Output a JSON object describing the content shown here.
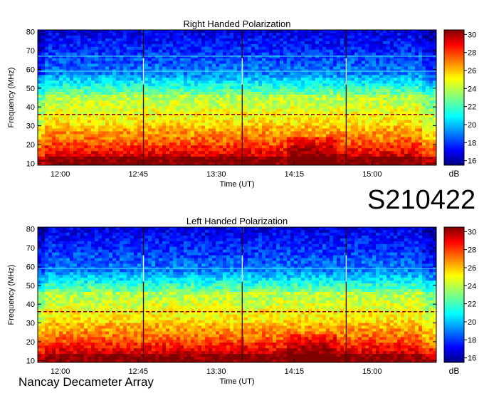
{
  "observation_code": "S210422",
  "footer": "Nancay Decameter Array",
  "chart_data": [
    {
      "type": "heatmap",
      "title": "Right Handed Polarization",
      "xlabel": "Time (UT)",
      "ylabel": "Frequency (MHz)",
      "x_ticks": [
        "12:00",
        "12:45",
        "13:30",
        "14:15",
        "15:00"
      ],
      "x_tick_minutes": [
        720,
        765,
        810,
        855,
        900
      ],
      "xlim_minutes": [
        707,
        937
      ],
      "y_ticks": [
        10,
        20,
        30,
        40,
        50,
        60,
        70,
        80
      ],
      "ylim": [
        9,
        81
      ],
      "colorbar": {
        "label": "dB",
        "ticks": [
          16,
          18,
          20,
          22,
          24,
          26,
          28,
          30
        ],
        "range": [
          15.5,
          30.5
        ],
        "colormap": "jet"
      },
      "bursts_minutes": [
        768,
        825,
        885
      ],
      "rfi_lines_mhz": [
        36,
        59,
        67
      ]
    },
    {
      "type": "heatmap",
      "title": "Left Handed Polarization",
      "xlabel": "Time (UT)",
      "ylabel": "Frequency (MHz)",
      "x_ticks": [
        "12:00",
        "12:45",
        "13:30",
        "14:15",
        "15:00"
      ],
      "x_tick_minutes": [
        720,
        765,
        810,
        855,
        900
      ],
      "xlim_minutes": [
        707,
        937
      ],
      "y_ticks": [
        10,
        20,
        30,
        40,
        50,
        60,
        70,
        80
      ],
      "ylim": [
        9,
        81
      ],
      "colorbar": {
        "label": "dB",
        "ticks": [
          16,
          18,
          20,
          22,
          24,
          26,
          28,
          30
        ],
        "range": [
          15.5,
          30.5
        ],
        "colormap": "jet"
      },
      "bursts_minutes": [
        768,
        825,
        885
      ],
      "rfi_lines_mhz": [
        36,
        59
      ]
    }
  ]
}
